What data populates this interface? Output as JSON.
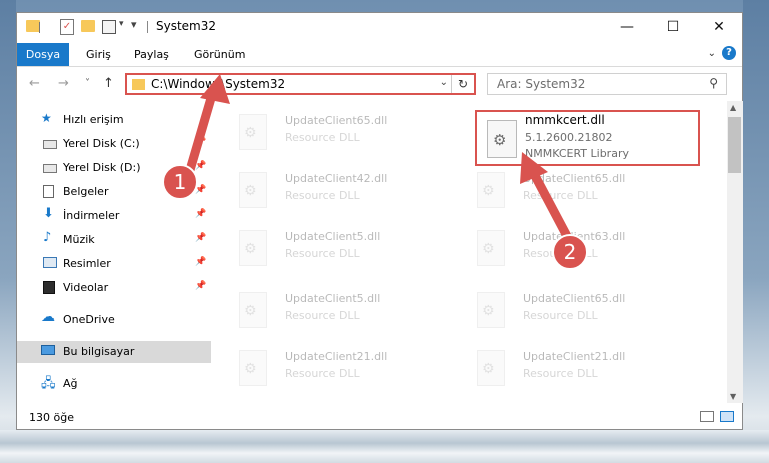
{
  "window": {
    "title": "System32",
    "controls": {
      "minimize": "—",
      "maximize": "☐",
      "close": "✕"
    }
  },
  "ribbon": {
    "tabs": [
      "Dosya",
      "Giriş",
      "Paylaş",
      "Görünüm"
    ],
    "help": "?"
  },
  "navigation": {
    "back": "←",
    "forward": "→",
    "recent": "˅",
    "up": "↑",
    "address": "C:\\Windows\\System32",
    "search_placeholder": "Ara: System32"
  },
  "sidebar": {
    "quick_access": "Hızlı erişim",
    "items": [
      {
        "label": "Yerel Disk (C:)",
        "icon": "drive-icon",
        "pinned": true
      },
      {
        "label": "Yerel Disk (D:)",
        "icon": "drive-icon",
        "pinned": true
      },
      {
        "label": "Belgeler",
        "icon": "documents-icon",
        "pinned": true
      },
      {
        "label": "İndirmeler",
        "icon": "download-icon",
        "pinned": true
      },
      {
        "label": "Müzik",
        "icon": "music-icon",
        "pinned": true
      },
      {
        "label": "Resimler",
        "icon": "pictures-icon",
        "pinned": true
      },
      {
        "label": "Videolar",
        "icon": "videos-icon",
        "pinned": true
      }
    ],
    "onedrive": "OneDrive",
    "this_pc": "Bu bilgisayar",
    "network": "Ağ"
  },
  "files": [
    {
      "name": "UpdateClient65.dll",
      "type": "Resource DLL"
    },
    {
      "name": "UpdateClient42.dll",
      "type": "Resource DLL"
    },
    {
      "name": "UpdateClient65.dll",
      "type": "Resource DLL"
    },
    {
      "name": "UpdateClient5.dll",
      "type": "Resource DLL"
    },
    {
      "name": "UpdateClient63.dll",
      "type": "Resource DLL"
    },
    {
      "name": "UpdateClient5.dll",
      "type": "Resource DLL"
    },
    {
      "name": "UpdateClient65.dll",
      "type": "Resource DLL"
    },
    {
      "name": "UpdateClient21.dll",
      "type": "Resource DLL"
    },
    {
      "name": "UpdateClient21.dll",
      "type": "Resource DLL"
    }
  ],
  "highlighted_file": {
    "name": "nmmkcert.dll",
    "version": "5.1.2600.21802",
    "description": "NMMKCERT Library"
  },
  "annotations": {
    "step1": "1",
    "step2": "2",
    "color": "#d9534f"
  },
  "status": {
    "item_count": "130 öğe"
  },
  "colors": {
    "accent": "#1979ca",
    "highlight": "#d9534f"
  }
}
